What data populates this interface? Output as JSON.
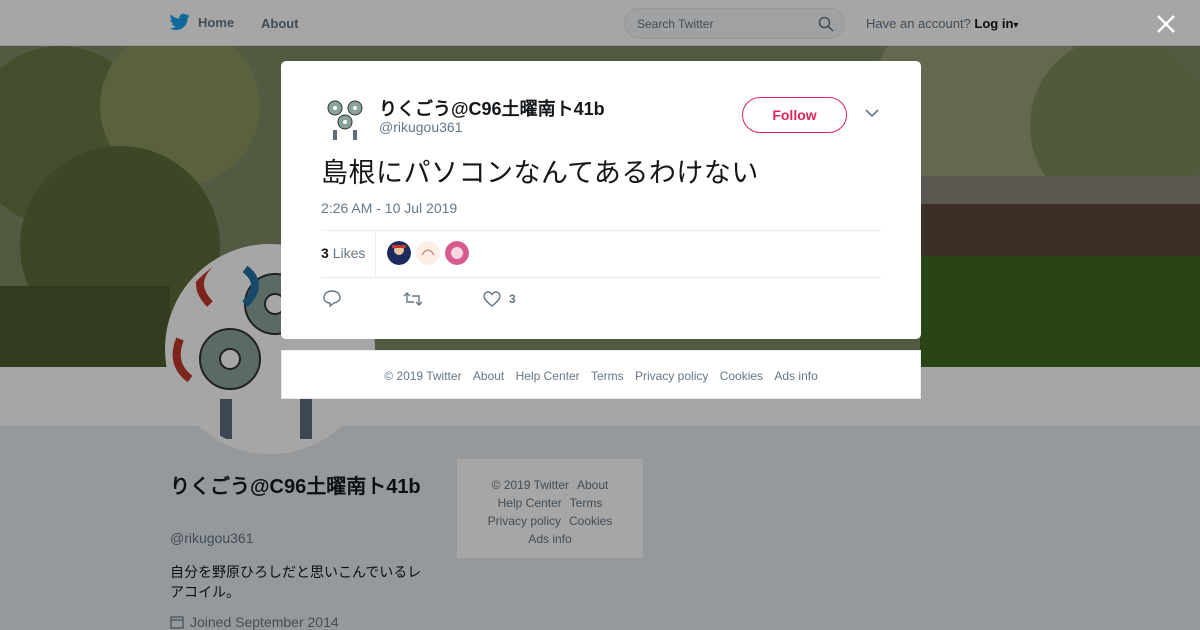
{
  "topbar": {
    "home_label": "Home",
    "about_label": "About",
    "search_placeholder": "Search Twitter",
    "have_account": "Have an account?",
    "login_label": "Log in"
  },
  "profile": {
    "name": "りくごう@C96土曜南ト41b",
    "handle": "@rikugou361",
    "bio": "自分を野原ひろしだと思いこんでいるレアコイル。",
    "joined": "Joined September 2014"
  },
  "side_footer": {
    "links": [
      "© 2019 Twitter",
      "About",
      "Help Center",
      "Terms",
      "Privacy policy",
      "Cookies",
      "Ads info"
    ]
  },
  "tweet": {
    "author_name": "りくごう@C96土曜南ト41b",
    "author_handle": "@rikugou361",
    "follow_label": "Follow",
    "text": "島根にパソコンなんてあるわけない",
    "timestamp": "2:26 AM - 10 Jul 2019",
    "likes_count": "3",
    "likes_label": "Likes",
    "like_action_count": "3"
  },
  "modal_footer": {
    "links": [
      "© 2019 Twitter",
      "About",
      "Help Center",
      "Terms",
      "Privacy policy",
      "Cookies",
      "Ads info"
    ]
  },
  "colors": {
    "twitter_blue": "#1da1f2",
    "follow_red": "#e0245e",
    "muted_text": "#657786"
  }
}
